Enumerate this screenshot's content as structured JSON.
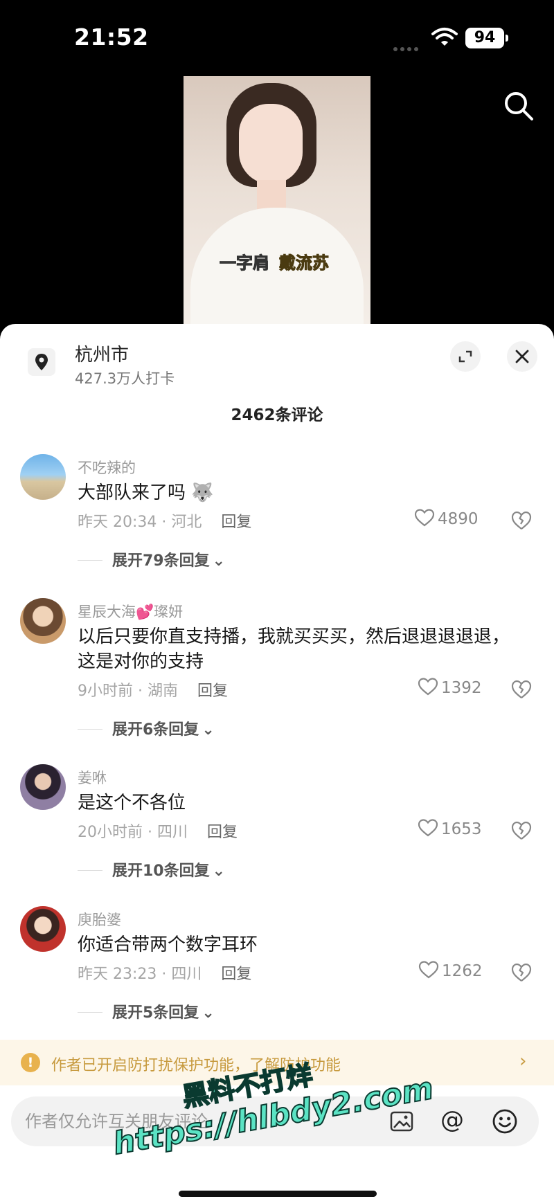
{
  "status": {
    "time": "21:52",
    "battery": "94"
  },
  "video": {
    "caption_left": "一字肩",
    "caption_right": "戴流苏"
  },
  "location": {
    "title": "杭州市",
    "subtitle": "427.3万人打卡"
  },
  "comment_count": "2462条评论",
  "comments": [
    {
      "user": "不吃辣的",
      "text": "大部队来了吗 🐺",
      "time": "昨天 20:34 · 河北",
      "reply": "回复",
      "likes": "4890",
      "expand": "展开79条回复"
    },
    {
      "user": "星辰大海💕璨妍",
      "text": "以后只要你直支持播，我就买买买，然后退退退退退，这是对你的支持",
      "time": "9小时前 · 湖南",
      "reply": "回复",
      "likes": "1392",
      "expand": "展开6条回复"
    },
    {
      "user": "姜咻",
      "text": "是这个不各位",
      "time": "20小时前 · 四川",
      "reply": "回复",
      "likes": "1653",
      "expand": "展开10条回复"
    },
    {
      "user": "庾胎婆",
      "text": "你适合带两个数字耳环",
      "time": "昨天 23:23 · 四川",
      "reply": "回复",
      "likes": "1262",
      "expand": "展开5条回复"
    }
  ],
  "notice": {
    "icon": "!",
    "text": "作者已开启防打扰保护功能，了解防护功能",
    "arrow": "›"
  },
  "input": {
    "placeholder": "作者仅允许互关朋友评论",
    "at": "@"
  },
  "watermark": {
    "line1": "黑料不打烊",
    "line2": "https://hlbdy2.com"
  },
  "colors": {
    "notice_bg": "#fdf6e8",
    "notice_text": "#c79a3e",
    "watermark": "#5be3c4"
  }
}
